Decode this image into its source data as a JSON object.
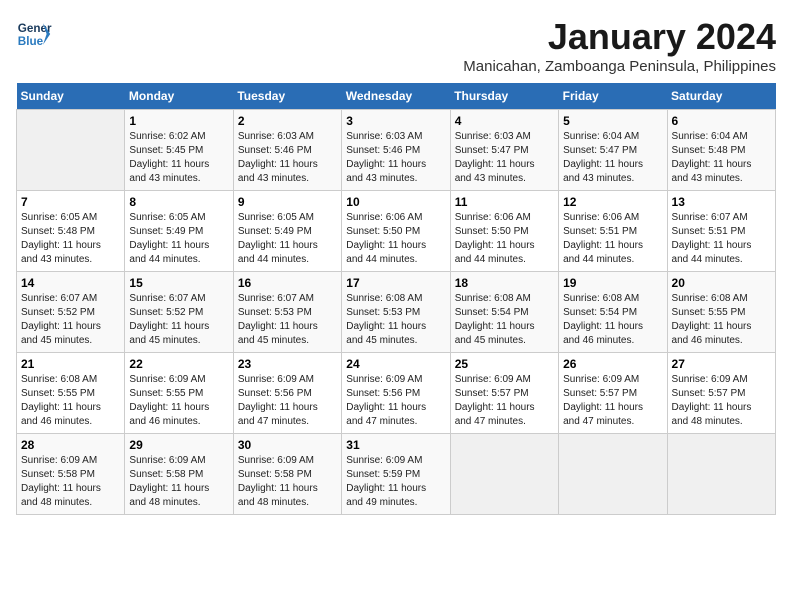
{
  "logo": {
    "line1": "General",
    "line2": "Blue"
  },
  "title": "January 2024",
  "subtitle": "Manicahan, Zamboanga Peninsula, Philippines",
  "days_of_week": [
    "Sunday",
    "Monday",
    "Tuesday",
    "Wednesday",
    "Thursday",
    "Friday",
    "Saturday"
  ],
  "weeks": [
    [
      {
        "day": "",
        "info": ""
      },
      {
        "day": "1",
        "info": "Sunrise: 6:02 AM\nSunset: 5:45 PM\nDaylight: 11 hours\nand 43 minutes."
      },
      {
        "day": "2",
        "info": "Sunrise: 6:03 AM\nSunset: 5:46 PM\nDaylight: 11 hours\nand 43 minutes."
      },
      {
        "day": "3",
        "info": "Sunrise: 6:03 AM\nSunset: 5:46 PM\nDaylight: 11 hours\nand 43 minutes."
      },
      {
        "day": "4",
        "info": "Sunrise: 6:03 AM\nSunset: 5:47 PM\nDaylight: 11 hours\nand 43 minutes."
      },
      {
        "day": "5",
        "info": "Sunrise: 6:04 AM\nSunset: 5:47 PM\nDaylight: 11 hours\nand 43 minutes."
      },
      {
        "day": "6",
        "info": "Sunrise: 6:04 AM\nSunset: 5:48 PM\nDaylight: 11 hours\nand 43 minutes."
      }
    ],
    [
      {
        "day": "7",
        "info": "Sunrise: 6:05 AM\nSunset: 5:48 PM\nDaylight: 11 hours\nand 43 minutes."
      },
      {
        "day": "8",
        "info": "Sunrise: 6:05 AM\nSunset: 5:49 PM\nDaylight: 11 hours\nand 44 minutes."
      },
      {
        "day": "9",
        "info": "Sunrise: 6:05 AM\nSunset: 5:49 PM\nDaylight: 11 hours\nand 44 minutes."
      },
      {
        "day": "10",
        "info": "Sunrise: 6:06 AM\nSunset: 5:50 PM\nDaylight: 11 hours\nand 44 minutes."
      },
      {
        "day": "11",
        "info": "Sunrise: 6:06 AM\nSunset: 5:50 PM\nDaylight: 11 hours\nand 44 minutes."
      },
      {
        "day": "12",
        "info": "Sunrise: 6:06 AM\nSunset: 5:51 PM\nDaylight: 11 hours\nand 44 minutes."
      },
      {
        "day": "13",
        "info": "Sunrise: 6:07 AM\nSunset: 5:51 PM\nDaylight: 11 hours\nand 44 minutes."
      }
    ],
    [
      {
        "day": "14",
        "info": "Sunrise: 6:07 AM\nSunset: 5:52 PM\nDaylight: 11 hours\nand 45 minutes."
      },
      {
        "day": "15",
        "info": "Sunrise: 6:07 AM\nSunset: 5:52 PM\nDaylight: 11 hours\nand 45 minutes."
      },
      {
        "day": "16",
        "info": "Sunrise: 6:07 AM\nSunset: 5:53 PM\nDaylight: 11 hours\nand 45 minutes."
      },
      {
        "day": "17",
        "info": "Sunrise: 6:08 AM\nSunset: 5:53 PM\nDaylight: 11 hours\nand 45 minutes."
      },
      {
        "day": "18",
        "info": "Sunrise: 6:08 AM\nSunset: 5:54 PM\nDaylight: 11 hours\nand 45 minutes."
      },
      {
        "day": "19",
        "info": "Sunrise: 6:08 AM\nSunset: 5:54 PM\nDaylight: 11 hours\nand 46 minutes."
      },
      {
        "day": "20",
        "info": "Sunrise: 6:08 AM\nSunset: 5:55 PM\nDaylight: 11 hours\nand 46 minutes."
      }
    ],
    [
      {
        "day": "21",
        "info": "Sunrise: 6:08 AM\nSunset: 5:55 PM\nDaylight: 11 hours\nand 46 minutes."
      },
      {
        "day": "22",
        "info": "Sunrise: 6:09 AM\nSunset: 5:55 PM\nDaylight: 11 hours\nand 46 minutes."
      },
      {
        "day": "23",
        "info": "Sunrise: 6:09 AM\nSunset: 5:56 PM\nDaylight: 11 hours\nand 47 minutes."
      },
      {
        "day": "24",
        "info": "Sunrise: 6:09 AM\nSunset: 5:56 PM\nDaylight: 11 hours\nand 47 minutes."
      },
      {
        "day": "25",
        "info": "Sunrise: 6:09 AM\nSunset: 5:57 PM\nDaylight: 11 hours\nand 47 minutes."
      },
      {
        "day": "26",
        "info": "Sunrise: 6:09 AM\nSunset: 5:57 PM\nDaylight: 11 hours\nand 47 minutes."
      },
      {
        "day": "27",
        "info": "Sunrise: 6:09 AM\nSunset: 5:57 PM\nDaylight: 11 hours\nand 48 minutes."
      }
    ],
    [
      {
        "day": "28",
        "info": "Sunrise: 6:09 AM\nSunset: 5:58 PM\nDaylight: 11 hours\nand 48 minutes."
      },
      {
        "day": "29",
        "info": "Sunrise: 6:09 AM\nSunset: 5:58 PM\nDaylight: 11 hours\nand 48 minutes."
      },
      {
        "day": "30",
        "info": "Sunrise: 6:09 AM\nSunset: 5:58 PM\nDaylight: 11 hours\nand 48 minutes."
      },
      {
        "day": "31",
        "info": "Sunrise: 6:09 AM\nSunset: 5:59 PM\nDaylight: 11 hours\nand 49 minutes."
      },
      {
        "day": "",
        "info": ""
      },
      {
        "day": "",
        "info": ""
      },
      {
        "day": "",
        "info": ""
      }
    ]
  ]
}
